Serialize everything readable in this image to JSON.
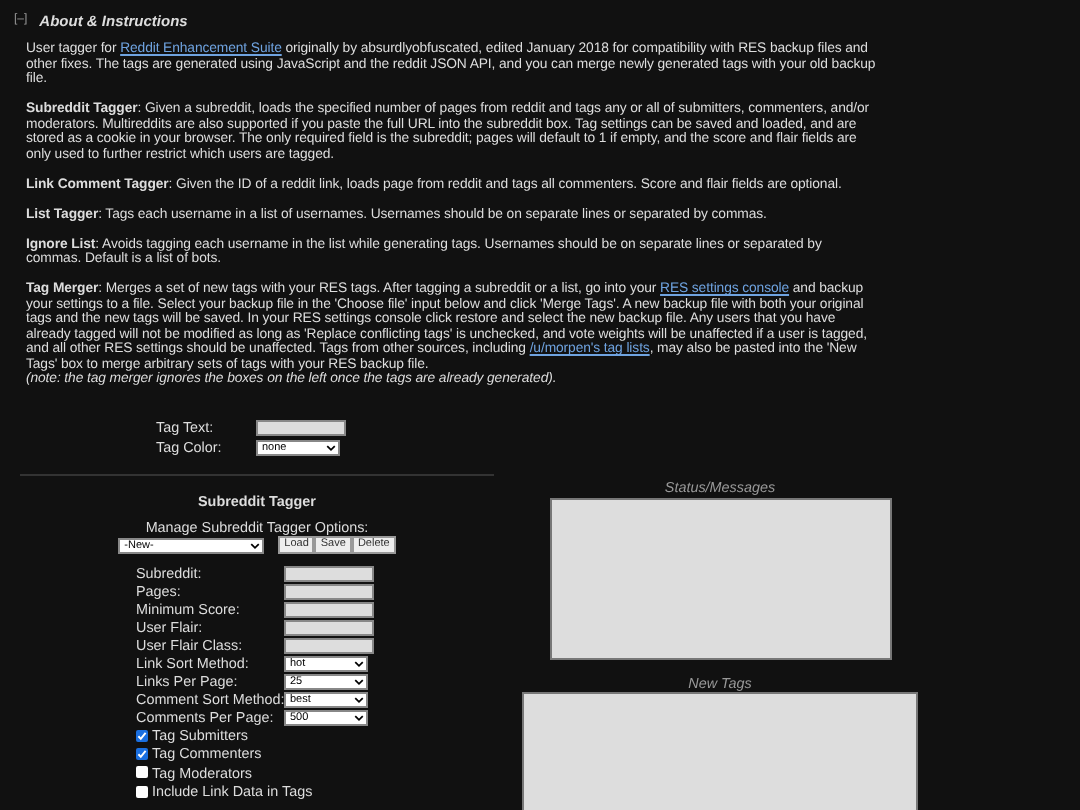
{
  "section": {
    "toggle": "[–]",
    "title": "About & Instructions"
  },
  "paragraphs": [
    {
      "segments": [
        {
          "kind": "text",
          "text": "User tagger for "
        },
        {
          "kind": "link",
          "text": "Reddit Enhancement Suite"
        },
        {
          "kind": "text",
          "text": " originally by absurdlyobfuscated, edited January 2018 for compatibility with RES backup files and other fixes. The tags are generated using JavaScript and the reddit JSON API, and you can merge newly generated tags with your old backup file."
        }
      ]
    },
    {
      "segments": [
        {
          "kind": "text",
          "text": "**Subreddit Tagger**: Given a subreddit, loads the specified number of pages from reddit and tags any or all of submitters, commenters, and/or moderators. Multireddits are also supported if you paste the full URL into the subreddit box. Tag settings can be saved and loaded, and are stored as a cookie in your browser. The only required field is the subreddit; pages will default to 1 if empty, and the score and flair fields are only used to further restrict which users are tagged."
        }
      ]
    },
    {
      "segments": [
        {
          "kind": "text",
          "text": "**Link Comment Tagger**: Given the ID of a reddit link, loads page from reddit and tags all commenters. Score and flair fields are optional."
        }
      ]
    },
    {
      "segments": [
        {
          "kind": "text",
          "text": "**List Tagger**: Tags each username in a list of usernames. Usernames should be on separate lines or separated by commas."
        }
      ]
    },
    {
      "segments": [
        {
          "kind": "text",
          "text": "**Ignore List**: Avoids tagging each username in the list while generating tags. Usernames should be on separate lines or separated by commas. Default is a list of bots."
        }
      ]
    },
    {
      "segments": [
        {
          "kind": "text",
          "text": "**Tag Merger**: Merges a set of new tags with your RES tags. After tagging a subreddit or a list, go into your "
        },
        {
          "kind": "link",
          "text": "RES settings console"
        },
        {
          "kind": "text",
          "text": " and backup your settings to a file. Select your backup file in the 'Choose file' input below and click 'Merge Tags'. A new backup file with both your original tags and the new tags will be saved. In your RES settings console click restore and select the new backup file. Any users that you have already tagged will not be modified as long as 'Replace conflicting tags' is unchecked, and vote weights will be unaffected if a user is tagged, and all other RES settings should be unaffected. Tags from other sources, including "
        },
        {
          "kind": "link",
          "text": "/u/morpen's tag lists"
        },
        {
          "kind": "text",
          "text": ", may also be pasted into the 'New Tags' box to merge arbitrary sets of tags with your RES backup file."
        }
      ],
      "note": "(note: the tag merger ignores the boxes on the left once the tags are already generated)."
    }
  ],
  "tag_fields": [
    {
      "label": "Tag Text:",
      "kind": "text"
    },
    {
      "label": "Tag Color:",
      "kind": "select",
      "value": "none"
    }
  ],
  "subreddit_tagger": {
    "title": "Subreddit Tagger",
    "manage_label": "Manage Subreddit Tagger Options:",
    "preset": "-New-",
    "buttons": [
      "Load",
      "Save",
      "Delete"
    ],
    "fields": [
      {
        "label": "Subreddit:",
        "kind": "text"
      },
      {
        "label": "Pages:",
        "kind": "text"
      },
      {
        "label": "Minimum Score:",
        "kind": "text"
      },
      {
        "label": "User Flair:",
        "kind": "text"
      },
      {
        "label": "User Flair Class:",
        "kind": "text"
      },
      {
        "label": "Link Sort Method:",
        "kind": "select",
        "value": "hot"
      },
      {
        "label": "Links Per Page:",
        "kind": "select",
        "value": "25"
      },
      {
        "label": "Comment Sort Method:",
        "kind": "select",
        "value": "best"
      },
      {
        "label": "Comments Per Page:",
        "kind": "select",
        "value": "500"
      }
    ],
    "checkboxes": [
      {
        "label": "Tag Submitters",
        "checked": true
      },
      {
        "label": "Tag Commenters",
        "checked": true
      },
      {
        "label": "Tag Moderators",
        "checked": false
      },
      {
        "label": "Include Link Data in Tags",
        "checked": false
      }
    ]
  },
  "panels": [
    {
      "label": "Status/Messages",
      "kind": "small"
    },
    {
      "label": "New Tags",
      "kind": "large"
    }
  ]
}
